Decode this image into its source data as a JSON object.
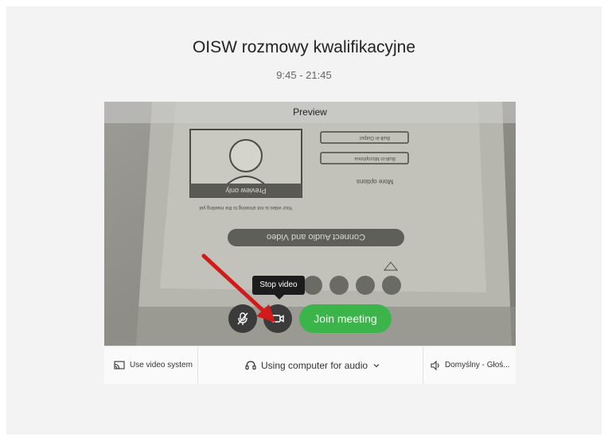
{
  "meeting": {
    "title": "OISW rozmowy kwalifikacyjne",
    "time": "9:45 - 21:45"
  },
  "preview": {
    "label": "Preview",
    "photo_text": {
      "preview_only": "Preview only",
      "notice": "Your video is not showing to the meeting yet",
      "connect": "Connect Audio and Video",
      "more": "More options",
      "opt1": "Built-in Output",
      "opt2": "Built-in Microphone"
    }
  },
  "controls": {
    "tooltip": "Stop video",
    "join_label": "Join meeting",
    "mute_icon": "microphone-muted-icon",
    "video_icon": "camera-icon"
  },
  "bottom_bar": {
    "video_system": "Use video system",
    "audio": "Using computer for audio",
    "speaker": "Domyślny - Głoś..."
  },
  "colors": {
    "join": "#3bb54a",
    "arrow": "#d11b1b",
    "control": "#3b3b3b"
  }
}
